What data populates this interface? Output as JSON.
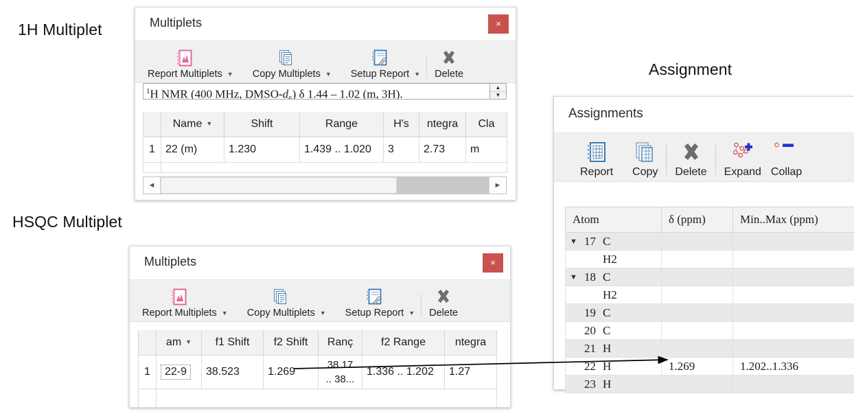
{
  "annotations": {
    "h1_multiplet": "1H Multiplet",
    "hsqc_multiplet": "HSQC Multiplet",
    "assignment": "Assignment"
  },
  "multiplets_1h": {
    "title": "Multiplets",
    "close_label": "×",
    "toolbar": [
      {
        "label": "Report Multiplets",
        "icon": "report-multiplets-icon",
        "has_dropdown": true
      },
      {
        "label": "Copy Multiplets",
        "icon": "copy-multiplets-icon",
        "has_dropdown": true
      },
      {
        "label": "Setup Report",
        "icon": "setup-report-icon",
        "has_dropdown": true
      },
      {
        "label": "Delete",
        "icon": "delete-icon",
        "has_dropdown": false
      }
    ],
    "report_text": {
      "prefix_sup": "1",
      "body_1": "H NMR (400 MHz, DMSO-",
      "italic_d": "d",
      "sub_6": "6",
      "body_2": ") δ 1.44 – 1.02 (m, 3H)."
    },
    "columns": [
      "Name",
      "Shift",
      "Range",
      "H's",
      "ntegra",
      "Cla"
    ],
    "rows": [
      {
        "index": "1",
        "name": "22 (m)",
        "shift": "1.230",
        "range": "1.439 .. 1.020",
        "hs": "3",
        "integral": "2.73",
        "class": "m"
      }
    ],
    "scroll": {
      "left_arrow": "◄",
      "right_arrow": "►",
      "thumb_percent": 72
    }
  },
  "multiplets_hsqc": {
    "title": "Multiplets",
    "close_label": "×",
    "toolbar": [
      {
        "label": "Report Multiplets",
        "icon": "report-multiplets-icon",
        "has_dropdown": true
      },
      {
        "label": "Copy Multiplets",
        "icon": "copy-multiplets-icon",
        "has_dropdown": true
      },
      {
        "label": "Setup Report",
        "icon": "setup-report-icon",
        "has_dropdown": true
      },
      {
        "label": "Delete",
        "icon": "delete-icon",
        "has_dropdown": false
      }
    ],
    "columns": [
      "am",
      "f1 Shift",
      "f2 Shift",
      "Ranç",
      "f2 Range",
      "ntegra"
    ],
    "rows": [
      {
        "index": "1",
        "name": "22-9",
        "f1_shift": "38.523",
        "f2_shift": "1.269",
        "f1_range_line1": "38.17",
        "f1_range_line2": ".. 38...",
        "f2_range": "1.336 .. 1.202",
        "integral": "1.27"
      }
    ]
  },
  "assignments": {
    "title": "Assignments",
    "toolbar": [
      {
        "label": "Report",
        "icon": "report-icon"
      },
      {
        "label": "Copy",
        "icon": "copy-icon"
      },
      {
        "label": "Delete",
        "icon": "delete-icon"
      },
      {
        "label": "Expand",
        "icon": "expand-icon"
      },
      {
        "label": "Collap",
        "icon": "collapse-icon"
      }
    ],
    "columns": [
      "Atom",
      "δ (ppm)",
      "Min..Max (ppm)"
    ],
    "rows": [
      {
        "chevron": "❯",
        "num": "17",
        "elem": "C",
        "delta": "",
        "minmax": "",
        "shade": "alt"
      },
      {
        "chevron": "",
        "num": "",
        "elem": "H2",
        "delta": "",
        "minmax": "",
        "shade": "norm"
      },
      {
        "chevron": "❯",
        "num": "18",
        "elem": "C",
        "delta": "",
        "minmax": "",
        "shade": "alt"
      },
      {
        "chevron": "",
        "num": "",
        "elem": "H2",
        "delta": "",
        "minmax": "",
        "shade": "norm"
      },
      {
        "chevron": "",
        "num": "19",
        "elem": "C",
        "delta": "",
        "minmax": "",
        "shade": "alt"
      },
      {
        "chevron": "",
        "num": "20",
        "elem": "C",
        "delta": "",
        "minmax": "",
        "shade": "norm"
      },
      {
        "chevron": "",
        "num": "21",
        "elem": "H",
        "delta": "",
        "minmax": "",
        "shade": "alt"
      },
      {
        "chevron": "",
        "num": "22",
        "elem": "H",
        "delta": "1.269",
        "minmax": "1.202..1.336",
        "shade": "norm"
      },
      {
        "chevron": "",
        "num": "23",
        "elem": "H",
        "delta": "",
        "minmax": "",
        "shade": "alt"
      }
    ]
  },
  "colors": {
    "close_red": "#c9524f",
    "toolbar_bg": "#f0f0f0",
    "header_bg": "#f2f2f2",
    "row_alt": "#e9e9e9",
    "icon_pink": "#e2689a",
    "icon_blue": "#3a78b5",
    "icon_gray": "#6e6e6e",
    "icon_red": "#d14f4f",
    "icon_darkblue": "#2233cc"
  }
}
